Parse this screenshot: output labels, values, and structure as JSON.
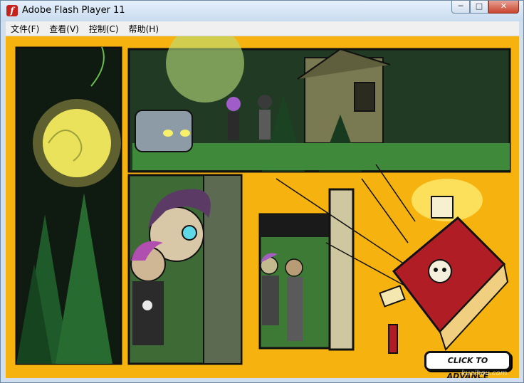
{
  "window": {
    "title": "Adobe Flash Player 11",
    "app_icon": "flash-player-icon"
  },
  "controls": {
    "minimize": "─",
    "maximize": "□",
    "close": "✕"
  },
  "menu": [
    {
      "label": "文件(F)"
    },
    {
      "label": "查看(V)"
    },
    {
      "label": "控制(C)"
    },
    {
      "label": "帮助(H)"
    }
  ],
  "content": {
    "advance_label": "CLICK TO ADVANCE",
    "watermark": "kuaihou.com"
  },
  "colors": {
    "stage_background": "#f6b30f",
    "comic_border": "#111111",
    "book_red": "#b01d24"
  }
}
